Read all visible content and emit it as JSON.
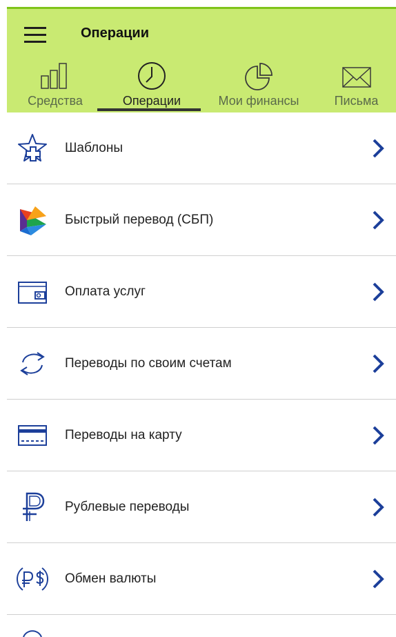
{
  "header": {
    "title": "Операции",
    "tabs": [
      {
        "label": "Средства",
        "icon": "bar-chart-icon"
      },
      {
        "label": "Операции",
        "icon": "clock-icon",
        "active": true
      },
      {
        "label": "Мои финансы",
        "icon": "pie-chart-icon"
      },
      {
        "label": "Письма",
        "icon": "envelope-icon"
      }
    ]
  },
  "menu": {
    "items": [
      {
        "label": "Шаблоны",
        "icon": "star-plus-icon"
      },
      {
        "label": "Быстрый перевод (СБП)",
        "icon": "sbp-logo-icon"
      },
      {
        "label": "Оплата услуг",
        "icon": "wallet-icon"
      },
      {
        "label": "Переводы по своим счетам",
        "icon": "swap-arrows-icon"
      },
      {
        "label": "Переводы на карту",
        "icon": "card-icon"
      },
      {
        "label": "Рублевые переводы",
        "icon": "ruble-icon"
      },
      {
        "label": "Обмен валюты",
        "icon": "currency-exchange-icon"
      }
    ]
  },
  "colors": {
    "header_bg": "#c9ea72",
    "accent_line": "#7fc41a",
    "icon_blue": "#1c3f9a"
  }
}
